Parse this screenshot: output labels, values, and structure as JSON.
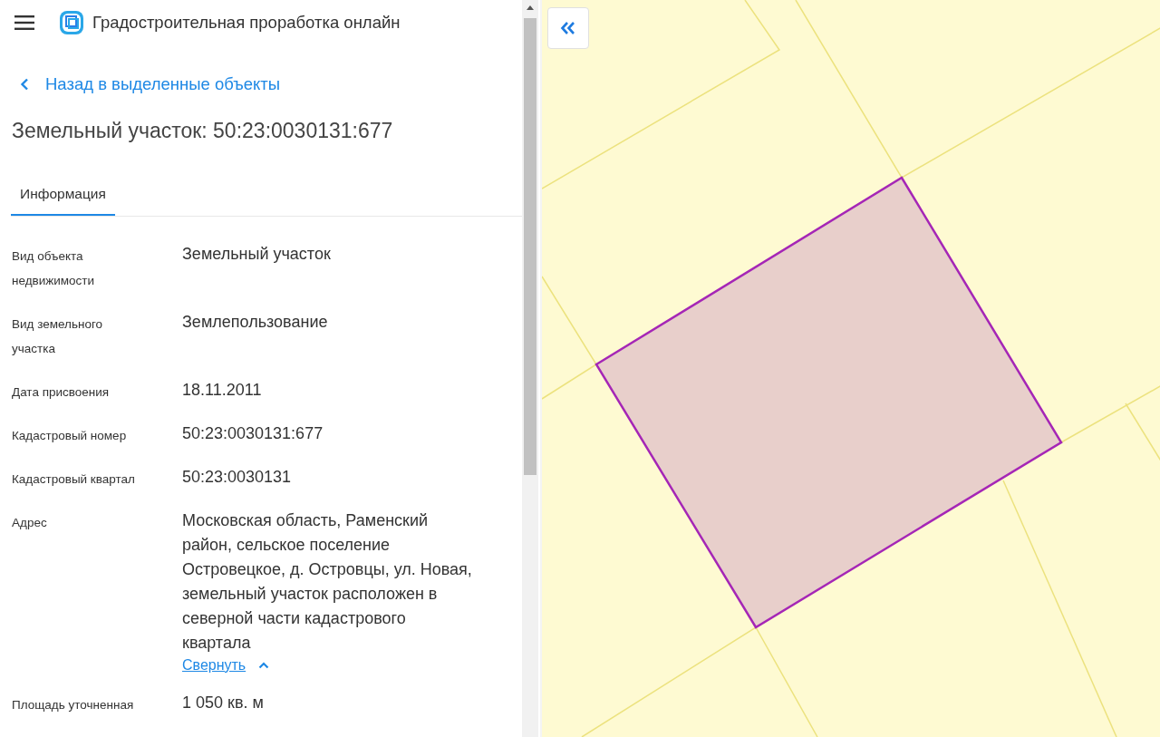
{
  "app_title": "Градостроительная проработка онлайн",
  "back_link": "Назад в выделенные объекты",
  "object_title": "Земельный участок: 50:23:0030131:677",
  "tabs": [
    {
      "label": "Информация",
      "selected": true
    }
  ],
  "properties": [
    {
      "label": "Вид объекта недвижимости",
      "value": "Земельный участок"
    },
    {
      "label": "Вид земельного участка",
      "value": "Землепользование"
    },
    {
      "label": "Дата присвоения",
      "value": "18.11.2011"
    },
    {
      "label": "Кадастровый номер",
      "value": "50:23:0030131:677"
    },
    {
      "label": "Кадастровый квартал",
      "value": "50:23:0030131"
    },
    {
      "label": "Адрес",
      "value": "Московская область, Раменский район, сельское поселение Островецкое, д. Островцы, ул. Новая, земельный участок расположен в северной части кадастрового квартала",
      "toggle": "Свернуть",
      "expanded": true
    },
    {
      "label": "Площадь уточненная",
      "value": "1 050 кв. м"
    }
  ]
}
